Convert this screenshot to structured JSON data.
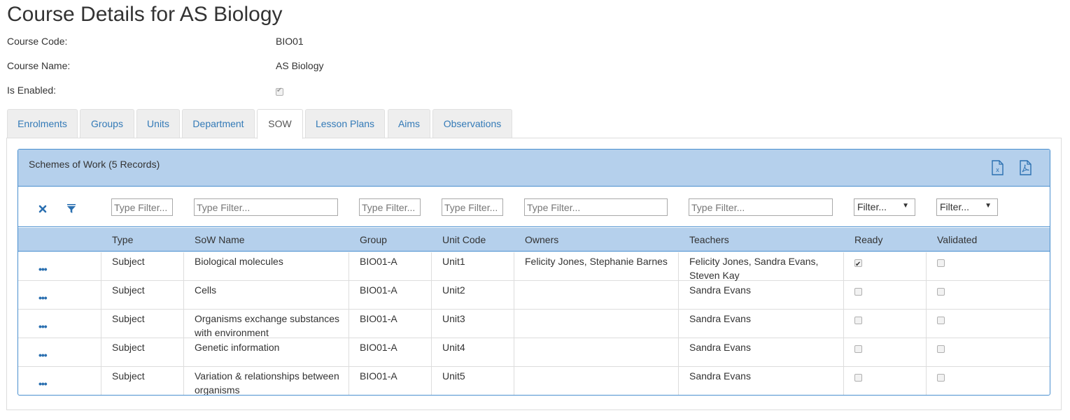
{
  "page": {
    "title": "Course Details for AS Biology"
  },
  "details": [
    {
      "label": "Course Code:",
      "value": "BIO01"
    },
    {
      "label": "Course Name:",
      "value": "AS Biology"
    },
    {
      "label": "Is Enabled:",
      "value_checked": true
    }
  ],
  "tabs": [
    {
      "label": "Enrolments",
      "active": false
    },
    {
      "label": "Groups",
      "active": false
    },
    {
      "label": "Units",
      "active": false
    },
    {
      "label": "Department",
      "active": false
    },
    {
      "label": "SOW",
      "active": true
    },
    {
      "label": "Lesson Plans",
      "active": false
    },
    {
      "label": "Aims",
      "active": false
    },
    {
      "label": "Observations",
      "active": false
    }
  ],
  "grid": {
    "title": "Schemes of Work (5 Records)",
    "export_icons": [
      "excel-export-icon",
      "pdf-export-icon"
    ],
    "filters": {
      "text_placeholder": "Type Filter...",
      "select_placeholder": "Filter...",
      "clear_icon": "clear-filter-icon",
      "filter_icon": "funnel-icon"
    },
    "columns": [
      "Type",
      "SoW Name",
      "Group",
      "Unit Code",
      "Owners",
      "Teachers",
      "Ready",
      "Validated"
    ],
    "rows": [
      {
        "type": "Subject",
        "sow_name": "Biological molecules",
        "group": "BIO01-A",
        "unit_code": "Unit1",
        "owners": "Felicity Jones, Stephanie Barnes",
        "teachers": "Felicity Jones, Sandra Evans, Steven Kay",
        "ready": true,
        "validated": false
      },
      {
        "type": "Subject",
        "sow_name": "Cells",
        "group": "BIO01-A",
        "unit_code": "Unit2",
        "owners": "",
        "teachers": "Sandra Evans",
        "ready": false,
        "validated": false
      },
      {
        "type": "Subject",
        "sow_name": "Organisms exchange substances with environment",
        "group": "BIO01-A",
        "unit_code": "Unit3",
        "owners": "",
        "teachers": "Sandra Evans",
        "ready": false,
        "validated": false
      },
      {
        "type": "Subject",
        "sow_name": "Genetic information",
        "group": "BIO01-A",
        "unit_code": "Unit4",
        "owners": "",
        "teachers": "Sandra Evans",
        "ready": false,
        "validated": false
      },
      {
        "type": "Subject",
        "sow_name": "Variation & relationships between organisms",
        "group": "BIO01-A",
        "unit_code": "Unit5",
        "owners": "",
        "teachers": "Sandra Evans",
        "ready": false,
        "validated": false
      }
    ],
    "row_action_label": "•••"
  },
  "colors": {
    "link": "#337ab7",
    "grid_header": "#b5d0ec",
    "grid_border": "#4a8fcf"
  }
}
